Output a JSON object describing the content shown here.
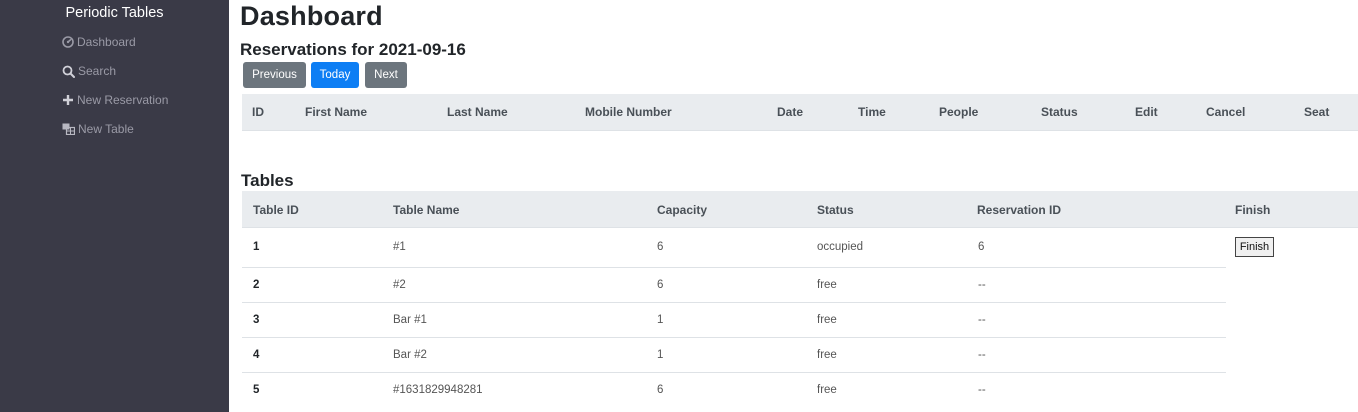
{
  "sidebar": {
    "brand": "Periodic Tables",
    "items": [
      {
        "label": "Dashboard",
        "icon": "dashboard-icon"
      },
      {
        "label": "Search",
        "icon": "search-icon"
      },
      {
        "label": "New Reservation",
        "icon": "plus-icon"
      },
      {
        "label": "New Table",
        "icon": "table-icon"
      }
    ]
  },
  "main": {
    "title": "Dashboard",
    "reservations_heading": "Reservations for 2021-09-16",
    "buttons": {
      "previous": "Previous",
      "today": "Today",
      "next": "Next"
    },
    "reservation_columns": [
      "ID",
      "First Name",
      "Last Name",
      "Mobile Number",
      "Date",
      "Time",
      "People",
      "Status",
      "Edit",
      "Cancel",
      "Seat"
    ],
    "tables_heading": "Tables",
    "table_columns": [
      "Table ID",
      "Table Name",
      "Capacity",
      "Status",
      "Reservation ID",
      "Finish"
    ],
    "tables": [
      {
        "id": "1",
        "name": "#1",
        "capacity": "6",
        "status": "occupied",
        "reservation_id": "6"
      },
      {
        "id": "2",
        "name": "#2",
        "capacity": "6",
        "status": "free",
        "reservation_id": "--"
      },
      {
        "id": "3",
        "name": "Bar #1",
        "capacity": "1",
        "status": "free",
        "reservation_id": "--"
      },
      {
        "id": "4",
        "name": "Bar #2",
        "capacity": "1",
        "status": "free",
        "reservation_id": "--"
      },
      {
        "id": "5",
        "name": "#1631829948281",
        "capacity": "6",
        "status": "free",
        "reservation_id": "--"
      }
    ],
    "finish_label": "Finish"
  },
  "colors": {
    "sidebar_bg": "#3a3a47",
    "primary": "#0d7ef4",
    "secondary": "#6c757d",
    "table_header_bg": "#e9ecef"
  }
}
